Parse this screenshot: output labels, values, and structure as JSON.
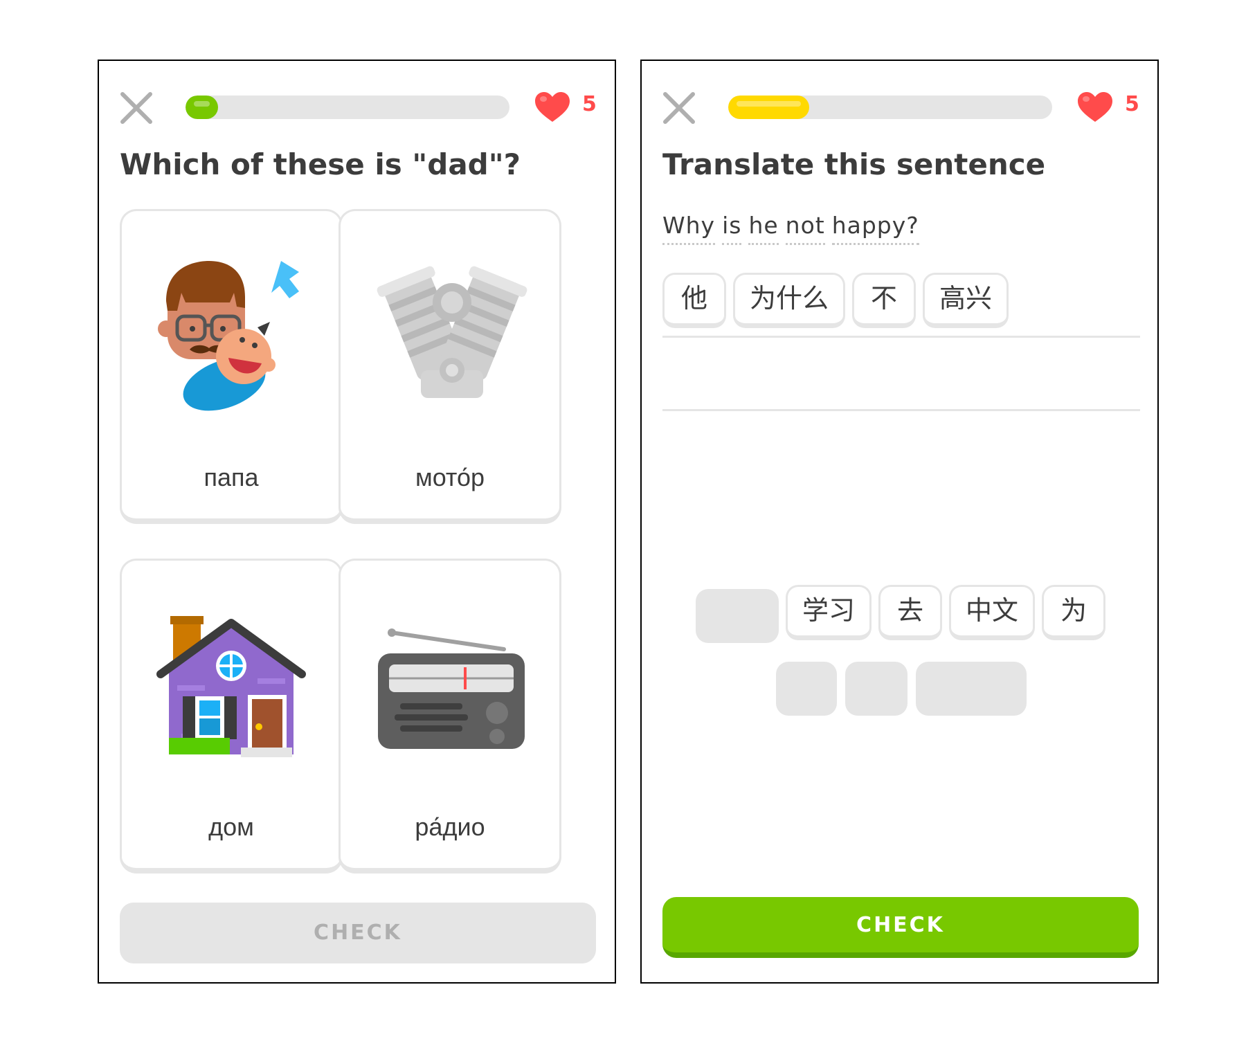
{
  "left_screen": {
    "hearts": "5",
    "progress": 0.1,
    "progress_color": "#78c800",
    "prompt": "Which of these is \"dad\"?",
    "options": [
      {
        "word": "папа",
        "icon": "father-and-baby-illustration"
      },
      {
        "word": "мото́р",
        "icon": "engine-illustration"
      },
      {
        "word": "дом",
        "icon": "house-illustration"
      },
      {
        "word": "ра́дио",
        "icon": "radio-illustration"
      }
    ],
    "check_label": "CHECK",
    "check_state": "disabled"
  },
  "right_screen": {
    "hearts": "5",
    "progress": 0.25,
    "progress_color": "#ffd900",
    "prompt": "Translate this sentence",
    "sentence_words": [
      "Why",
      "is",
      "he",
      "not",
      "happy?"
    ],
    "selected_tiles": [
      "他",
      "为什么",
      "不",
      "高兴"
    ],
    "word_bank": [
      "学习",
      "去",
      "中文",
      "为"
    ],
    "check_label": "CHECK",
    "check_state": "active",
    "colors": {
      "accent_green": "#78c800",
      "heart_red": "#ff4b4b"
    }
  }
}
